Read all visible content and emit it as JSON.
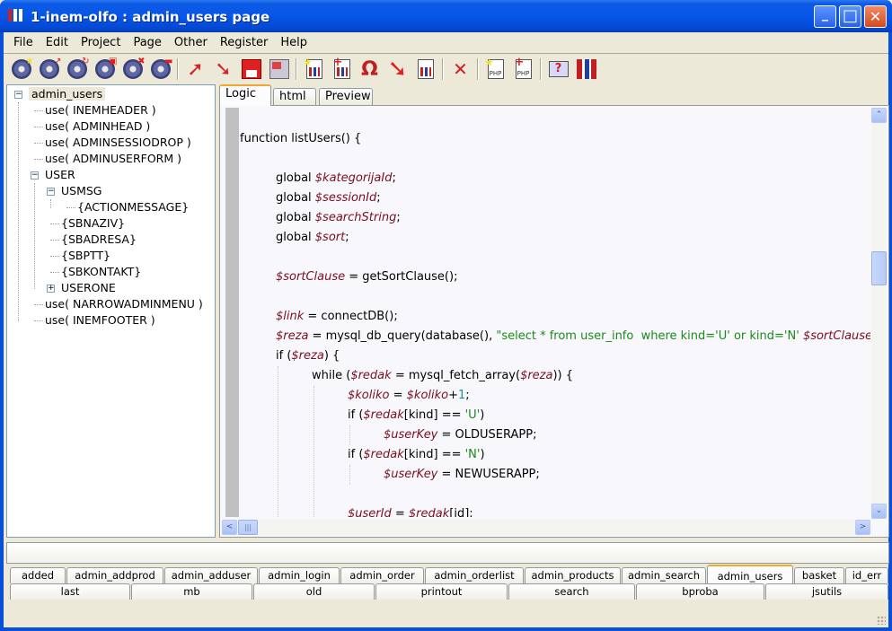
{
  "window": {
    "title": "1-inem-olfo : admin_users page",
    "minimize_label": "_",
    "maximize_label": "□",
    "close_label": "✕"
  },
  "menu": [
    "File",
    "Edit",
    "Project",
    "Page",
    "Other",
    "Register",
    "Help"
  ],
  "toolbar": {
    "groups": [
      [
        "new-project-icon",
        "open-project-icon",
        "reload-project-icon",
        "save-project-icon",
        "delete-project-icon",
        "export-project-icon"
      ],
      [
        "undo-icon",
        "redo-icon",
        "save-icon",
        "save-all-icon"
      ],
      [
        "new-page-icon",
        "add-page-icon",
        "refresh-icon",
        "import-icon",
        "page-icon"
      ],
      [
        "delete-icon"
      ],
      [
        "new-php-icon",
        "add-php-icon"
      ],
      [
        "help-icon",
        "about-icon"
      ]
    ]
  },
  "tree": {
    "items": [
      {
        "label": "admin_users",
        "level": 0,
        "toggle": "minus",
        "selected": true
      },
      {
        "label": "use( INEMHEADER )",
        "level": 1
      },
      {
        "label": "use( ADMINHEAD )",
        "level": 1
      },
      {
        "label": "use( ADMINSESSIODROP )",
        "level": 1
      },
      {
        "label": "use( ADMINUSERFORM )",
        "level": 1
      },
      {
        "label": "USER",
        "level": 1,
        "toggle": "minus"
      },
      {
        "label": "USMSG",
        "level": 2,
        "toggle": "minus"
      },
      {
        "label": "{ACTIONMESSAGE}",
        "level": 3
      },
      {
        "label": "{SBNAZIV}",
        "level": 2
      },
      {
        "label": "{SBADRESA}",
        "level": 2
      },
      {
        "label": "{SBPTT}",
        "level": 2
      },
      {
        "label": "{SBKONTAKT}",
        "level": 2
      },
      {
        "label": "USERONE",
        "level": 2,
        "toggle": "plus"
      },
      {
        "label": "use( NARROWADMINMENU )",
        "level": 1
      },
      {
        "label": "use( INEMFOOTER )",
        "level": 1
      }
    ]
  },
  "editor": {
    "tabs": [
      {
        "label": "Logic",
        "active": true
      },
      {
        "label": "html",
        "active": false
      },
      {
        "label": "Preview",
        "active": false
      }
    ],
    "code_lines": [
      {
        "indent": 0,
        "parts": []
      },
      {
        "indent": 0,
        "parts": [
          [
            "t",
            "function listUsers() {"
          ]
        ]
      },
      {
        "indent": 0,
        "parts": []
      },
      {
        "indent": 1,
        "parts": [
          [
            "t",
            "global "
          ],
          [
            "v",
            "$kategorijaId"
          ],
          [
            "t",
            ";"
          ]
        ]
      },
      {
        "indent": 1,
        "parts": [
          [
            "t",
            "global "
          ],
          [
            "v",
            "$sessionId"
          ],
          [
            "t",
            ";"
          ]
        ]
      },
      {
        "indent": 1,
        "parts": [
          [
            "t",
            "global "
          ],
          [
            "v",
            "$searchString"
          ],
          [
            "t",
            ";"
          ]
        ]
      },
      {
        "indent": 1,
        "parts": [
          [
            "t",
            "global "
          ],
          [
            "v",
            "$sort"
          ],
          [
            "t",
            ";"
          ]
        ]
      },
      {
        "indent": 0,
        "parts": []
      },
      {
        "indent": 1,
        "parts": [
          [
            "v",
            "$sortClause"
          ],
          [
            "t",
            " = getSortClause();"
          ]
        ]
      },
      {
        "indent": 0,
        "parts": []
      },
      {
        "indent": 1,
        "parts": [
          [
            "v",
            "$link"
          ],
          [
            "t",
            " = connectDB();"
          ]
        ]
      },
      {
        "indent": 1,
        "parts": [
          [
            "v",
            "$reza"
          ],
          [
            "t",
            " = mysql_db_query(database(), "
          ],
          [
            "s",
            "\"select * from user_info  where kind='U' or kind='N' "
          ],
          [
            "v",
            "$sortClause"
          ],
          [
            "s",
            "\""
          ]
        ]
      },
      {
        "indent": 1,
        "parts": [
          [
            "t",
            "if ("
          ],
          [
            "v",
            "$reza"
          ],
          [
            "t",
            ") {"
          ]
        ]
      },
      {
        "indent": 2,
        "parts": [
          [
            "t",
            "while ("
          ],
          [
            "v",
            "$redak"
          ],
          [
            "t",
            " = mysql_fetch_array("
          ],
          [
            "v",
            "$reza"
          ],
          [
            "t",
            ")) {"
          ]
        ]
      },
      {
        "indent": 3,
        "parts": [
          [
            "v",
            "$koliko"
          ],
          [
            "t",
            " = "
          ],
          [
            "v",
            "$koliko"
          ],
          [
            "t",
            "+"
          ],
          [
            "n",
            "1"
          ],
          [
            "t",
            ";"
          ]
        ]
      },
      {
        "indent": 3,
        "parts": [
          [
            "t",
            "if ("
          ],
          [
            "v",
            "$redak"
          ],
          [
            "t",
            "[kind] == "
          ],
          [
            "s",
            "'U'"
          ],
          [
            "t",
            ")"
          ]
        ]
      },
      {
        "indent": 4,
        "parts": [
          [
            "v",
            "$userKey"
          ],
          [
            "t",
            " = OLDUSERAPP;"
          ]
        ]
      },
      {
        "indent": 3,
        "parts": [
          [
            "t",
            "if ("
          ],
          [
            "v",
            "$redak"
          ],
          [
            "t",
            "[kind] == "
          ],
          [
            "s",
            "'N'"
          ],
          [
            "t",
            ")"
          ]
        ]
      },
      {
        "indent": 4,
        "parts": [
          [
            "v",
            "$userKey"
          ],
          [
            "t",
            " = NEWUSERAPP;"
          ]
        ]
      },
      {
        "indent": 0,
        "parts": []
      },
      {
        "indent": 3,
        "parts": [
          [
            "v",
            "$userId"
          ],
          [
            "t",
            " = "
          ],
          [
            "v",
            "$redak"
          ],
          [
            "t",
            "[id];"
          ]
        ]
      }
    ],
    "scroll_up": "⌃",
    "scroll_down": "⌄",
    "scroll_left": "<",
    "scroll_right": ">",
    "vertical_scroll_position": 0.37
  },
  "status": {
    "text": ""
  },
  "page_tabs": {
    "row1": [
      {
        "label": "added"
      },
      {
        "label": "admin_addprod"
      },
      {
        "label": "admin_adduser"
      },
      {
        "label": "admin_login"
      },
      {
        "label": "admin_order"
      },
      {
        "label": "admin_orderlist"
      },
      {
        "label": "admin_products"
      },
      {
        "label": "admin_search"
      },
      {
        "label": "admin_users",
        "active": true
      },
      {
        "label": "basket"
      },
      {
        "label": "id_err"
      }
    ],
    "row2": [
      {
        "label": "last"
      },
      {
        "label": "mb"
      },
      {
        "label": "old"
      },
      {
        "label": "printout"
      },
      {
        "label": "search"
      },
      {
        "label": "bproba"
      },
      {
        "label": "jsutils"
      }
    ]
  },
  "colors": {
    "titlebar": "#0656e8",
    "variable": "#7a0e1e",
    "string": "#1a8a1a",
    "number": "#1a9090",
    "active_tab_accent": "#f0a830"
  }
}
